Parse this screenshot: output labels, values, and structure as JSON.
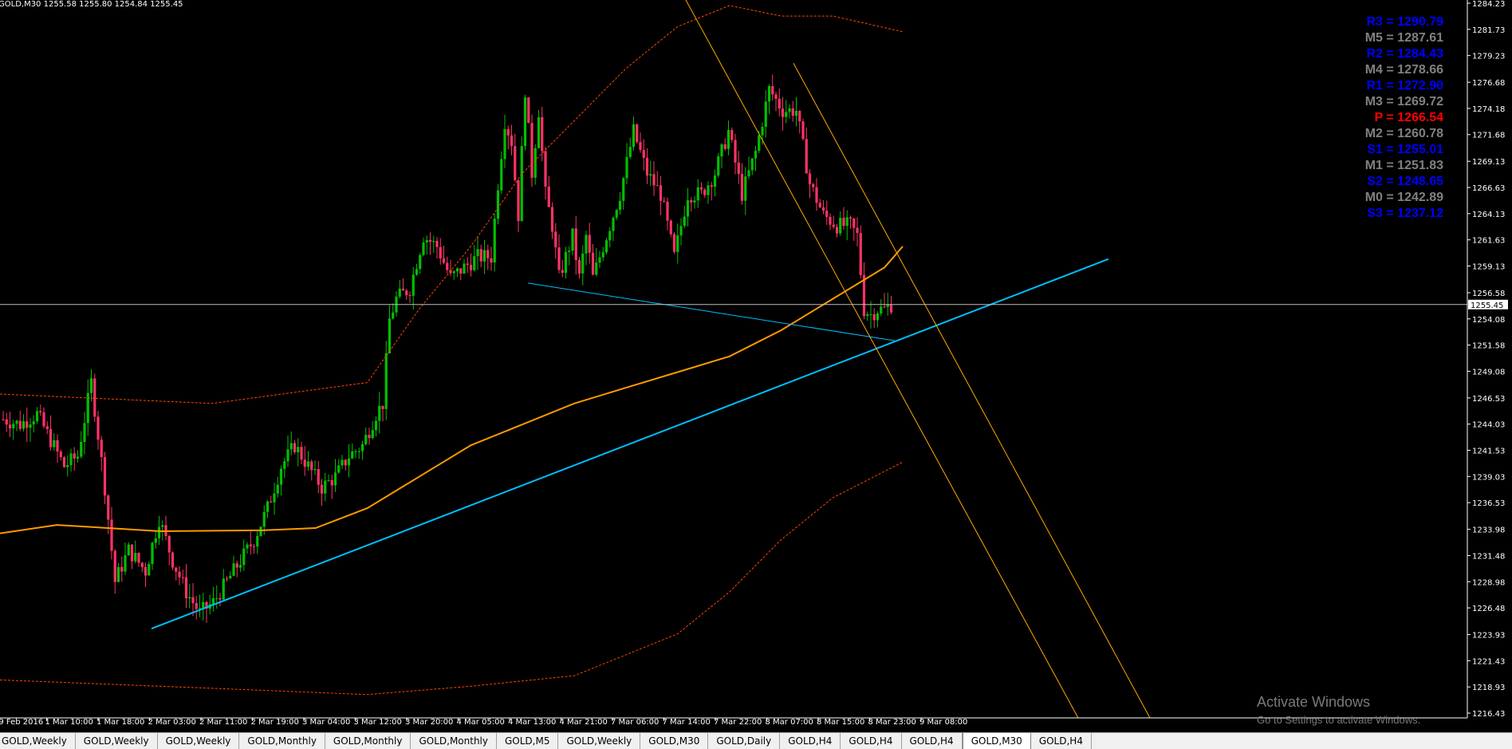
{
  "header": {
    "symbol_info": "GOLD,M30  1255.58 1255.80 1254.84 1255.45"
  },
  "watermark": {
    "title": "Activate Windows",
    "subtitle": "Go to Settings to activate Windows."
  },
  "pivots": [
    {
      "label": "R3",
      "value": "1290.79",
      "color": "#0000ff"
    },
    {
      "label": "M5",
      "value": "1287.61",
      "color": "#808080"
    },
    {
      "label": "R2",
      "value": "1284.43",
      "color": "#0000ff"
    },
    {
      "label": "M4",
      "value": "1278.66",
      "color": "#808080"
    },
    {
      "label": "R1",
      "value": "1272.90",
      "color": "#0000ff"
    },
    {
      "label": "M3",
      "value": "1269.72",
      "color": "#808080"
    },
    {
      "label": "P",
      "value": "1266.54",
      "color": "#ff0000"
    },
    {
      "label": "M2",
      "value": "1260.78",
      "color": "#808080"
    },
    {
      "label": "S1",
      "value": "1255.01",
      "color": "#0000ff"
    },
    {
      "label": "M1",
      "value": "1251.83",
      "color": "#808080"
    },
    {
      "label": "S2",
      "value": "1248.65",
      "color": "#0000ff"
    },
    {
      "label": "M0",
      "value": "1242.89",
      "color": "#808080"
    },
    {
      "label": "S3",
      "value": "1237.12",
      "color": "#0000ff"
    }
  ],
  "tabs": [
    {
      "label": "GOLD,Weekly",
      "active": false
    },
    {
      "label": "GOLD,Weekly",
      "active": false
    },
    {
      "label": "GOLD,Weekly",
      "active": false
    },
    {
      "label": "GOLD,Monthly",
      "active": false
    },
    {
      "label": "GOLD,Monthly",
      "active": false
    },
    {
      "label": "GOLD,Monthly",
      "active": false
    },
    {
      "label": "GOLD,M5",
      "active": false
    },
    {
      "label": "GOLD,Weekly",
      "active": false
    },
    {
      "label": "GOLD,M30",
      "active": false
    },
    {
      "label": "GOLD,Daily",
      "active": false
    },
    {
      "label": "GOLD,H4",
      "active": false
    },
    {
      "label": "GOLD,H4",
      "active": false
    },
    {
      "label": "GOLD,H4",
      "active": false
    },
    {
      "label": "GOLD,M30",
      "active": true
    },
    {
      "label": "GOLD,H4",
      "active": false
    }
  ],
  "colors": {
    "bull": "#00c000",
    "bear": "#ff3366",
    "ma": "#ff9900",
    "band": "#ff4400",
    "channel": "#ffaa00",
    "trend": "#00bfff",
    "grid_text": "#ffffff"
  },
  "chart_data": {
    "type": "candlestick",
    "symbol": "GOLD",
    "timeframe": "M30",
    "ylim": [
      1216.43,
      1284.23
    ],
    "y_ticks": [
      "1284.23",
      "1281.73",
      "1279.23",
      "1276.68",
      "1274.18",
      "1271.68",
      "1269.13",
      "1266.63",
      "1264.13",
      "1261.63",
      "1259.13",
      "1256.58",
      "1254.08",
      "1251.58",
      "1249.08",
      "1246.53",
      "1244.03",
      "1241.53",
      "1239.03",
      "1236.53",
      "1233.98",
      "1231.48",
      "1228.98",
      "1226.48",
      "1223.93",
      "1221.43",
      "1218.93",
      "1216.43"
    ],
    "x_ticks": [
      "29 Feb 2016",
      "1 Mar 10:00",
      "1 Mar 18:00",
      "2 Mar 03:00",
      "2 Mar 11:00",
      "2 Mar 19:00",
      "3 Mar 04:00",
      "3 Mar 12:00",
      "3 Mar 20:00",
      "4 Mar 05:00",
      "4 Mar 13:00",
      "4 Mar 21:00",
      "7 Mar 06:00",
      "7 Mar 14:00",
      "7 Mar 22:00",
      "8 Mar 07:00",
      "8 Mar 15:00",
      "8 Mar 23:00",
      "9 Mar 08:00"
    ],
    "current_price": "1255.45",
    "price_path": [
      [
        0,
        1244.5
      ],
      [
        5,
        1244
      ],
      [
        10,
        1245
      ],
      [
        18,
        1240
      ],
      [
        22,
        1241
      ],
      [
        26,
        1248
      ],
      [
        30,
        1238
      ],
      [
        33,
        1229
      ],
      [
        37,
        1232
      ],
      [
        42,
        1230
      ],
      [
        46,
        1235
      ],
      [
        50,
        1231
      ],
      [
        54,
        1228
      ],
      [
        58,
        1226
      ],
      [
        62,
        1227
      ],
      [
        66,
        1229
      ],
      [
        70,
        1231
      ],
      [
        74,
        1233
      ],
      [
        78,
        1236
      ],
      [
        82,
        1240
      ],
      [
        86,
        1242
      ],
      [
        90,
        1240
      ],
      [
        94,
        1238
      ],
      [
        98,
        1239
      ],
      [
        102,
        1241
      ],
      [
        106,
        1242
      ],
      [
        110,
        1245
      ],
      [
        112,
        1246
      ],
      [
        114,
        1254
      ],
      [
        116,
        1256
      ],
      [
        120,
        1257
      ],
      [
        124,
        1262
      ],
      [
        128,
        1261
      ],
      [
        132,
        1258
      ],
      [
        136,
        1259
      ],
      [
        140,
        1260
      ],
      [
        144,
        1260
      ],
      [
        146,
        1267
      ],
      [
        148,
        1273
      ],
      [
        150,
        1271
      ],
      [
        152,
        1264
      ],
      [
        154,
        1276
      ],
      [
        156,
        1268
      ],
      [
        158,
        1274
      ],
      [
        160,
        1266
      ],
      [
        162,
        1263
      ],
      [
        164,
        1258
      ],
      [
        166,
        1260
      ],
      [
        168,
        1262
      ],
      [
        170,
        1258
      ],
      [
        172,
        1262
      ],
      [
        174,
        1258
      ],
      [
        178,
        1262
      ],
      [
        182,
        1266
      ],
      [
        186,
        1272
      ],
      [
        190,
        1268
      ],
      [
        194,
        1266
      ],
      [
        198,
        1260
      ],
      [
        202,
        1266
      ],
      [
        206,
        1266
      ],
      [
        210,
        1268
      ],
      [
        214,
        1272
      ],
      [
        218,
        1266
      ],
      [
        222,
        1270
      ],
      [
        226,
        1276
      ],
      [
        230,
        1274
      ],
      [
        234,
        1274
      ],
      [
        238,
        1267
      ],
      [
        242,
        1264
      ],
      [
        246,
        1263
      ],
      [
        250,
        1263
      ],
      [
        252,
        1262
      ],
      [
        254,
        1255
      ],
      [
        256,
        1254.5
      ],
      [
        258,
        1255
      ],
      [
        260,
        1255
      ],
      [
        262,
        1255.45
      ]
    ],
    "moving_average": [
      [
        1218,
        1233.6
      ],
      [
        1240,
        1234.4
      ],
      [
        1280,
        1233.8
      ],
      [
        1320,
        1233.9
      ],
      [
        1340,
        1234.1
      ],
      [
        1360,
        1236
      ],
      [
        1380,
        1239
      ],
      [
        1400,
        1242
      ],
      [
        1420,
        1244
      ],
      [
        1440,
        1246
      ],
      [
        1460,
        1247.5
      ],
      [
        1480,
        1249
      ],
      [
        1500,
        1250.5
      ],
      [
        1520,
        1253
      ],
      [
        1540,
        1256
      ],
      [
        1560,
        1259
      ],
      [
        1567,
        1261
      ]
    ],
    "upper_band": [
      [
        1218,
        1246.9
      ],
      [
        1300,
        1246
      ],
      [
        1360,
        1248
      ],
      [
        1380,
        1255
      ],
      [
        1400,
        1261
      ],
      [
        1420,
        1268
      ],
      [
        1440,
        1273
      ],
      [
        1460,
        1278
      ],
      [
        1480,
        1282
      ],
      [
        1500,
        1284
      ],
      [
        1520,
        1283
      ],
      [
        1540,
        1283
      ],
      [
        1567,
        1281.5
      ]
    ],
    "lower_band": [
      [
        1218,
        1219.6
      ],
      [
        1300,
        1218.8
      ],
      [
        1360,
        1218.2
      ],
      [
        1400,
        1219
      ],
      [
        1440,
        1220
      ],
      [
        1480,
        1224
      ],
      [
        1500,
        1228
      ],
      [
        1520,
        1233
      ],
      [
        1540,
        1237
      ],
      [
        1567,
        1240.4
      ]
    ],
    "trend_line_main": {
      "from": [
        "2 Mar 03:00",
        1224.5
      ],
      "to": [
        "9 Mar 08:00+",
        1259.8
      ]
    },
    "trend_line_neck": {
      "from": [
        "4 Mar 13:00",
        1257.5
      ],
      "to": [
        "8 Mar 23:00+",
        1252.0
      ]
    },
    "channel_lines": [
      {
        "from": [
          "4 Mar 21:00",
          1285
        ],
        "to": [
          "9 Mar 08:00+",
          1216.43
        ]
      },
      {
        "from": [
          "8 Mar 07:00",
          1278.5
        ],
        "to": [
          "9 Mar 08:00++",
          1216.43
        ]
      }
    ]
  }
}
